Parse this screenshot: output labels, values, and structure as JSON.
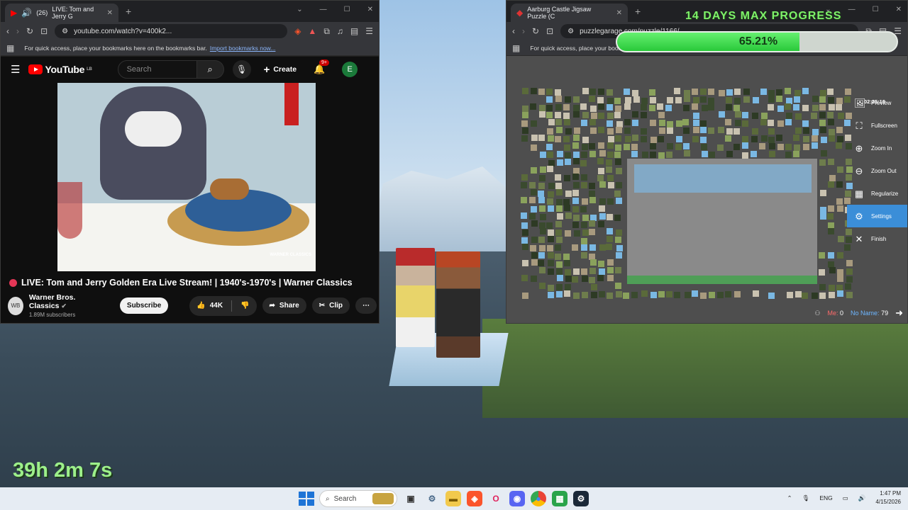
{
  "game": {
    "timer": "39h 2m 7s",
    "goal_title": "14 DAYS MAX PROGRESS",
    "progress_percent": 65.21,
    "progress_label": "65.21%"
  },
  "yt_window": {
    "tab": {
      "title": "LIVE: Tom and Jerry G",
      "count": "(26)"
    },
    "url": "youtube.com/watch?v=400k2...",
    "bookmarks_hint": "For quick access, place your bookmarks here on the bookmarks bar.",
    "bookmarks_link": "Import bookmarks now...",
    "header": {
      "logo": "YouTube",
      "logo_sup": "LB",
      "search_placeholder": "Search",
      "create_label": "Create",
      "notif_badge": "9+",
      "avatar_letter": "E"
    },
    "video": {
      "watermark": "WARNER CLASSICS",
      "title": "LIVE: Tom and Jerry Golden Era Live Stream! | 1940's-1970's | Warner Classics",
      "channel": "Warner Bros. Classics",
      "subscribers": "1.89M subscribers",
      "subscribe_label": "Subscribe",
      "likes": "44K",
      "share_label": "Share",
      "clip_label": "Clip"
    }
  },
  "pz_window": {
    "tab": {
      "title": "Aarburg Castle Jigsaw Puzzle (C"
    },
    "url": "puzzlegarage.com/puzzle/1166/",
    "bookmarks_hint": "For quick access, place your book",
    "clock": "02:25:19",
    "menu": [
      {
        "label": "Preview",
        "icon": "image-icon"
      },
      {
        "label": "Fullscreen",
        "icon": "fullscreen-icon"
      },
      {
        "label": "Zoom In",
        "icon": "zoom-in-icon"
      },
      {
        "label": "Zoom Out",
        "icon": "zoom-out-icon"
      },
      {
        "label": "Regularize",
        "icon": "grid-icon"
      },
      {
        "label": "Settings",
        "icon": "gear-icon"
      },
      {
        "label": "Finish",
        "icon": "close-icon"
      }
    ],
    "footer": {
      "me_label": "Me:",
      "me_value": "0",
      "noname_label": "No Name:",
      "noname_value": "79"
    }
  },
  "taskbar": {
    "search_placeholder": "Search",
    "lang": "ENG",
    "time": "1:47 PM",
    "date": "4/15/2026"
  },
  "colors": {
    "accent": "#3b8ed8",
    "youtube_red": "#ff0000",
    "progress": "#29c93a",
    "timer": "#9df08a"
  }
}
